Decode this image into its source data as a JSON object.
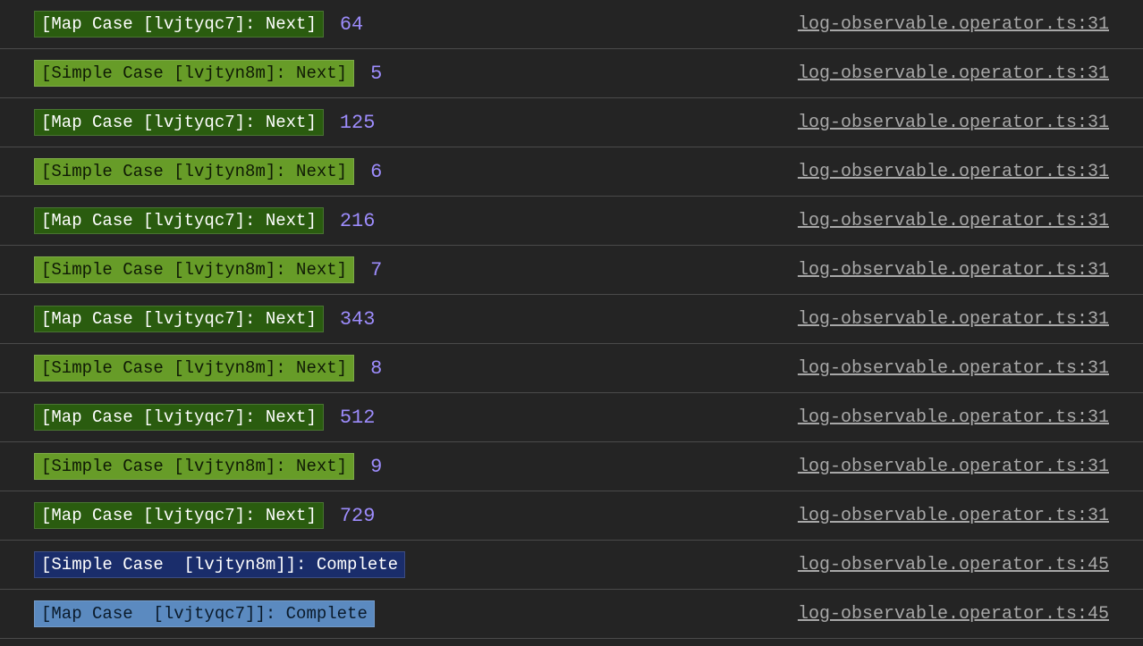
{
  "console": {
    "rows": [
      {
        "badge": "[Map Case [lvjtyqc7]: Next]",
        "badgeClass": "badge-map",
        "value": "64",
        "source": "log-observable.operator.ts:31"
      },
      {
        "badge": "[Simple Case [lvjtyn8m]: Next]",
        "badgeClass": "badge-simple",
        "value": "5",
        "source": "log-observable.operator.ts:31"
      },
      {
        "badge": "[Map Case [lvjtyqc7]: Next]",
        "badgeClass": "badge-map",
        "value": "125",
        "source": "log-observable.operator.ts:31"
      },
      {
        "badge": "[Simple Case [lvjtyn8m]: Next]",
        "badgeClass": "badge-simple",
        "value": "6",
        "source": "log-observable.operator.ts:31"
      },
      {
        "badge": "[Map Case [lvjtyqc7]: Next]",
        "badgeClass": "badge-map",
        "value": "216",
        "source": "log-observable.operator.ts:31"
      },
      {
        "badge": "[Simple Case [lvjtyn8m]: Next]",
        "badgeClass": "badge-simple",
        "value": "7",
        "source": "log-observable.operator.ts:31"
      },
      {
        "badge": "[Map Case [lvjtyqc7]: Next]",
        "badgeClass": "badge-map",
        "value": "343",
        "source": "log-observable.operator.ts:31"
      },
      {
        "badge": "[Simple Case [lvjtyn8m]: Next]",
        "badgeClass": "badge-simple",
        "value": "8",
        "source": "log-observable.operator.ts:31"
      },
      {
        "badge": "[Map Case [lvjtyqc7]: Next]",
        "badgeClass": "badge-map",
        "value": "512",
        "source": "log-observable.operator.ts:31"
      },
      {
        "badge": "[Simple Case [lvjtyn8m]: Next]",
        "badgeClass": "badge-simple",
        "value": "9",
        "source": "log-observable.operator.ts:31"
      },
      {
        "badge": "[Map Case [lvjtyqc7]: Next]",
        "badgeClass": "badge-map",
        "value": "729",
        "source": "log-observable.operator.ts:31"
      },
      {
        "badge": "[Simple Case  [lvjtyn8m]]: Complete",
        "badgeClass": "badge-complete-simple",
        "value": "",
        "source": "log-observable.operator.ts:45"
      },
      {
        "badge": "[Map Case  [lvjtyqc7]]: Complete",
        "badgeClass": "badge-complete-map",
        "value": "",
        "source": "log-observable.operator.ts:45"
      }
    ]
  }
}
